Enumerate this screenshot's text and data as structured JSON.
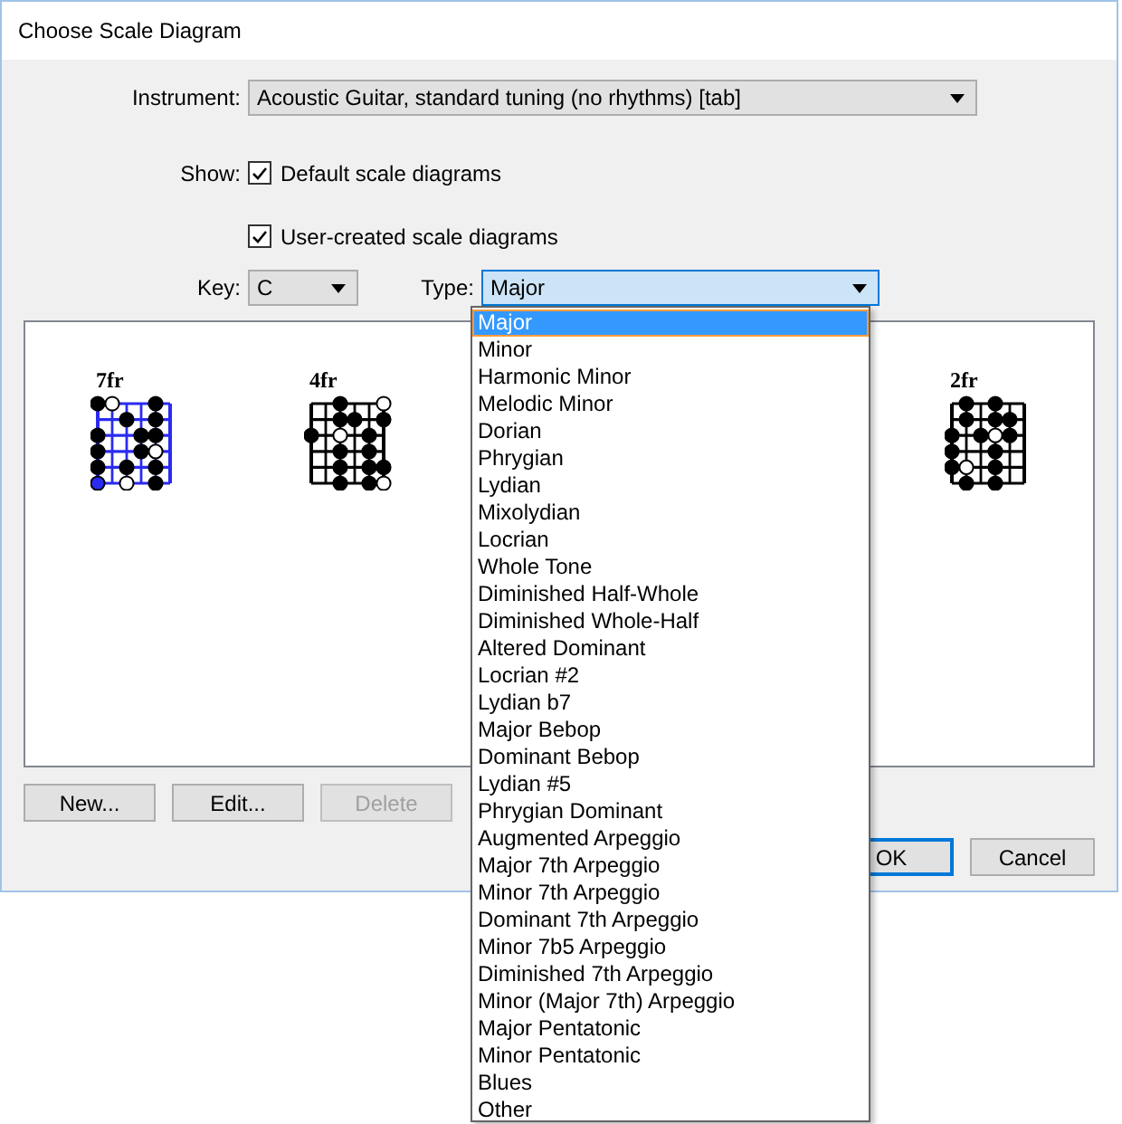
{
  "window": {
    "title": "Choose Scale Diagram"
  },
  "instrument": {
    "label": "Instrument:",
    "value": "Acoustic Guitar, standard tuning (no rhythms) [tab]"
  },
  "show": {
    "label": "Show:",
    "options": [
      {
        "label": "Default scale diagrams",
        "checked": true
      },
      {
        "label": "User-created scale diagrams",
        "checked": true
      }
    ]
  },
  "key": {
    "label": "Key:",
    "value": "C"
  },
  "type": {
    "label": "Type:",
    "value": "Major",
    "open": true,
    "options": [
      {
        "label": "Major",
        "selected": true
      },
      {
        "label": "Minor",
        "selected": false
      },
      {
        "label": "Harmonic Minor",
        "selected": false
      },
      {
        "label": "Melodic Minor",
        "selected": false
      },
      {
        "label": "Dorian",
        "selected": false
      },
      {
        "label": "Phrygian",
        "selected": false
      },
      {
        "label": "Lydian",
        "selected": false
      },
      {
        "label": "Mixolydian",
        "selected": false
      },
      {
        "label": "Locrian",
        "selected": false
      },
      {
        "label": "Whole Tone",
        "selected": false
      },
      {
        "label": "Diminished Half-Whole",
        "selected": false
      },
      {
        "label": "Diminished Whole-Half",
        "selected": false
      },
      {
        "label": "Altered Dominant",
        "selected": false
      },
      {
        "label": "Locrian #2",
        "selected": false
      },
      {
        "label": "Lydian b7",
        "selected": false
      },
      {
        "label": "Major Bebop",
        "selected": false
      },
      {
        "label": "Dominant Bebop",
        "selected": false
      },
      {
        "label": "Lydian #5",
        "selected": false
      },
      {
        "label": "Phrygian Dominant",
        "selected": false
      },
      {
        "label": "Augmented Arpeggio",
        "selected": false
      },
      {
        "label": "Major 7th Arpeggio",
        "selected": false
      },
      {
        "label": "Minor 7th Arpeggio",
        "selected": false
      },
      {
        "label": "Dominant 7th Arpeggio",
        "selected": false
      },
      {
        "label": "Minor 7b5 Arpeggio",
        "selected": false
      },
      {
        "label": "Diminished 7th Arpeggio",
        "selected": false
      },
      {
        "label": "Minor (Major 7th) Arpeggio",
        "selected": false
      },
      {
        "label": "Major Pentatonic",
        "selected": false
      },
      {
        "label": "Minor Pentatonic",
        "selected": false
      },
      {
        "label": "Blues",
        "selected": false
      },
      {
        "label": "Other",
        "selected": false
      }
    ]
  },
  "diagrams": [
    {
      "fret": "7fr",
      "selected": true
    },
    {
      "fret": "4fr",
      "selected": false
    },
    {
      "fret": "2fr",
      "selected": false
    }
  ],
  "buttons": [
    {
      "label": "New...",
      "disabled": false
    },
    {
      "label": "Edit...",
      "disabled": false
    },
    {
      "label": "Delete",
      "disabled": true
    }
  ],
  "dialog_buttons": [
    {
      "label": "OK",
      "default": true
    },
    {
      "label": "Cancel",
      "default": false
    }
  ]
}
